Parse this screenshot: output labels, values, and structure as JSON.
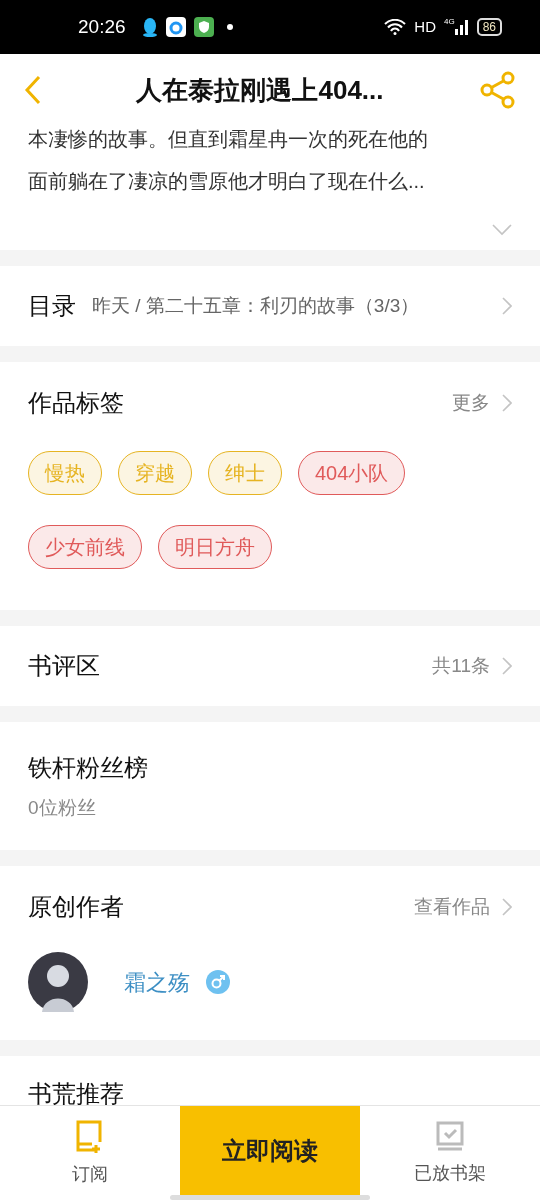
{
  "status_bar": {
    "time": "20:26",
    "network": "HD",
    "signal_label": "4G",
    "battery": "86"
  },
  "header": {
    "title": "人在泰拉刚遇上404..."
  },
  "description": {
    "lines": [
      "本凄惨的故事。但直到霜星冉一次的死在他的",
      "面前躺在了凄凉的雪原他才明白了现在什么..."
    ]
  },
  "catalog": {
    "label": "目录",
    "latest": "昨天 / 第二十五章：利刃的故事（3/3）"
  },
  "tags": {
    "title": "作品标签",
    "more": "更多",
    "items": [
      {
        "label": "慢热",
        "color": "#e6b422"
      },
      {
        "label": "穿越",
        "color": "#e6b422"
      },
      {
        "label": "绅士",
        "color": "#e6b422"
      },
      {
        "label": "404小队",
        "color": "#e05a5a"
      },
      {
        "label": "少女前线",
        "color": "#e05a5a"
      },
      {
        "label": "明日方舟",
        "color": "#e05a5a"
      }
    ]
  },
  "reviews": {
    "title": "书评区",
    "count": "共11条"
  },
  "fans": {
    "title": "铁杆粉丝榜",
    "count": "0位粉丝"
  },
  "author": {
    "title": "原创作者",
    "link": "查看作品",
    "name": "霜之殇"
  },
  "recommend": {
    "title": "书荒推荐"
  },
  "bottom_bar": {
    "subscribe": "订阅",
    "read": "立即阅读",
    "shelf": "已放书架"
  }
}
